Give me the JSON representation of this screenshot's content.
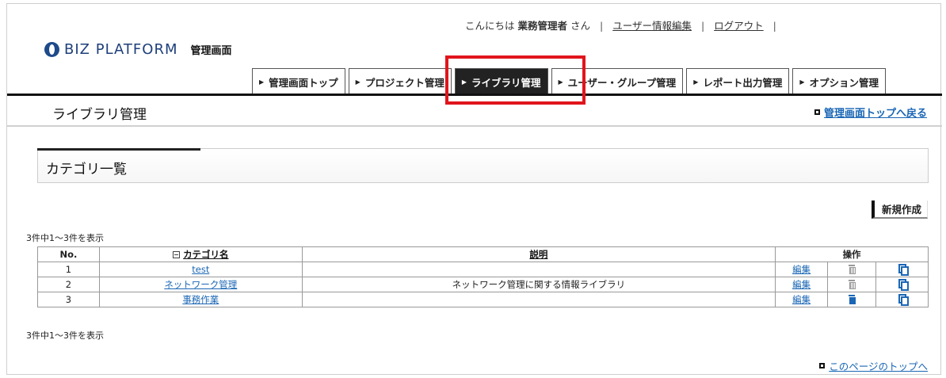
{
  "header": {
    "greeting_prefix": "こんにちは",
    "user_name": "業務管理者",
    "greeting_suffix": "さん",
    "separator": "|",
    "edit_user_link": "ユーザー情報編集",
    "logout_link": "ログアウト",
    "logo_text": "BIZ PLATFORM",
    "logo_subtitle": "管理画面"
  },
  "tabs": [
    {
      "label": "管理画面トップ",
      "active": false
    },
    {
      "label": "プロジェクト管理",
      "active": false
    },
    {
      "label": "ライブラリ管理",
      "active": true
    },
    {
      "label": "ユーザー・グループ管理",
      "active": false
    },
    {
      "label": "レポート出力管理",
      "active": false
    },
    {
      "label": "オプション管理",
      "active": false
    }
  ],
  "page": {
    "title": "ライブラリ管理",
    "back_link": "管理画面トップへ戻る"
  },
  "panel": {
    "title": "カテゴリ一覧",
    "new_button": "新規作成"
  },
  "count_text_top": "3件中1～3件を表示",
  "count_text_bottom": "3件中1～3件を表示",
  "table": {
    "headers": {
      "no": "No.",
      "name": "カテゴリ名",
      "description": "説明",
      "operations": "操作"
    },
    "rows": [
      {
        "no": "1",
        "name": "test",
        "description": "",
        "edit": "編集"
      },
      {
        "no": "2",
        "name": "ネットワーク管理",
        "description": "ネットワーク管理に関する情報ライブラリ",
        "edit": "編集"
      },
      {
        "no": "3",
        "name": "事務作業",
        "description": "",
        "edit": "編集"
      }
    ]
  },
  "footer": {
    "top_link": "このページのトップへ"
  },
  "colors": {
    "link": "#1a66b5",
    "active_tab_bg": "#222222",
    "highlight": "#e0151b"
  }
}
